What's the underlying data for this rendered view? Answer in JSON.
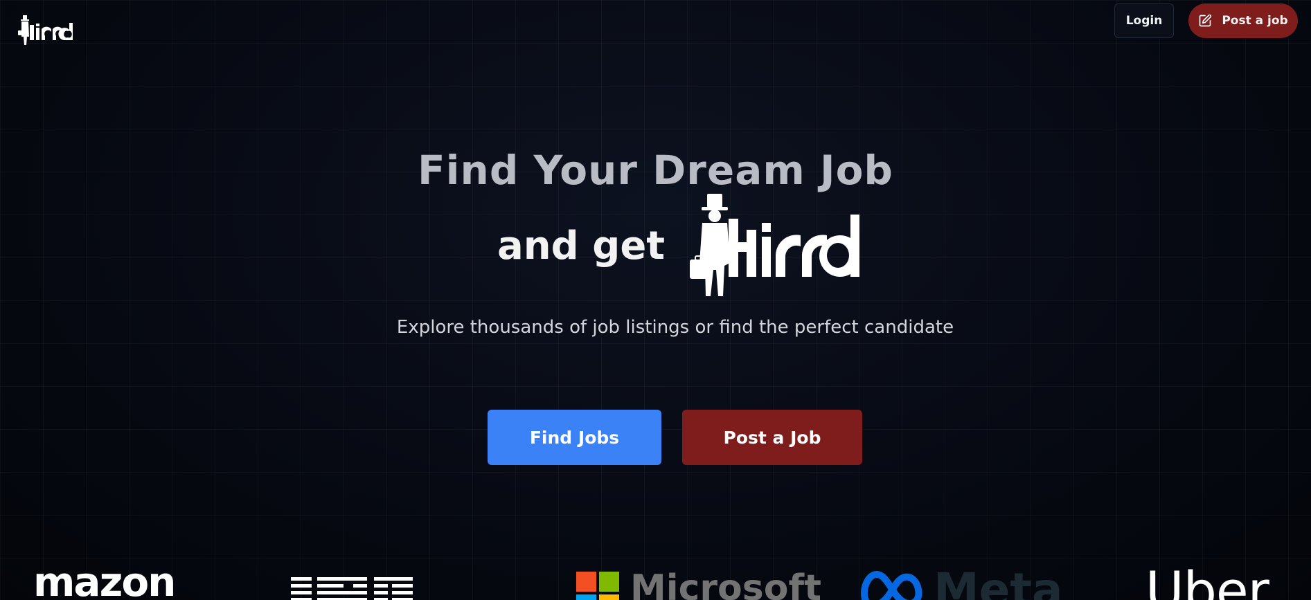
{
  "header": {
    "logo_text": "Hirrd",
    "login_label": "Login",
    "post_job_label": "Post a job",
    "post_job_icon": "pen-square-icon"
  },
  "hero": {
    "title": "Find Your Dream Job",
    "and_get": "and get",
    "logo_text": "Hirrd",
    "tagline": "Explore thousands of job listings or find the perfect candidate",
    "find_jobs_label": "Find Jobs",
    "post_job_label": "Post a Job"
  },
  "companies": {
    "amazon": "mazon",
    "ibm": "IBM",
    "microsoft": "Microsoft",
    "meta": "Meta",
    "uber": "Uber"
  },
  "colors": {
    "background": "#05070d",
    "primary_blue": "#3b82f6",
    "brand_red": "#7f1d1d"
  }
}
